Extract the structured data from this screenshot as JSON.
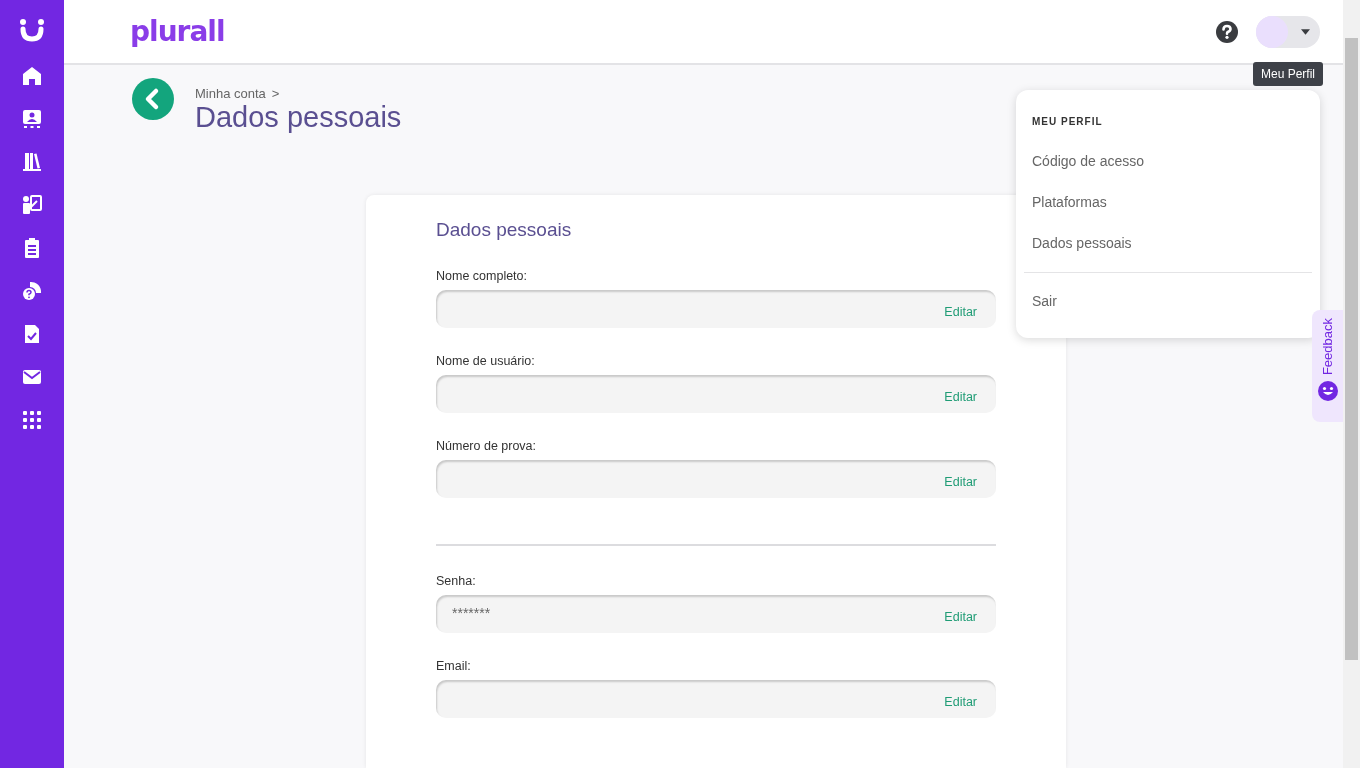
{
  "header": {
    "logo": "plurall",
    "tooltip": "Meu Perfil"
  },
  "page": {
    "breadcrumb": "Minha conta",
    "breadcrumb_separator": ">",
    "title": "Dados pessoais"
  },
  "card": {
    "title": "Dados pessoais",
    "field_groups": [
      [
        {
          "label": "Nome completo:",
          "action": "Editar"
        },
        {
          "label": "Nome de usuário:",
          "action": "Editar"
        },
        {
          "label": "Número de prova:",
          "action": "Editar"
        }
      ],
      [
        {
          "label": "Senha:",
          "value": "*******",
          "action": "Editar"
        },
        {
          "label": "Email:",
          "action": "Editar"
        }
      ]
    ]
  },
  "profile_menu": {
    "heading": "MEU PERFIL",
    "items": [
      {
        "label": "Código de acesso",
        "kind": "link"
      },
      {
        "label": "Plataformas",
        "kind": "link"
      },
      {
        "label": "Dados pessoais",
        "kind": "link"
      },
      {
        "label": "Sair",
        "kind": "logout"
      }
    ]
  },
  "feedback": {
    "label": "Feedback"
  }
}
